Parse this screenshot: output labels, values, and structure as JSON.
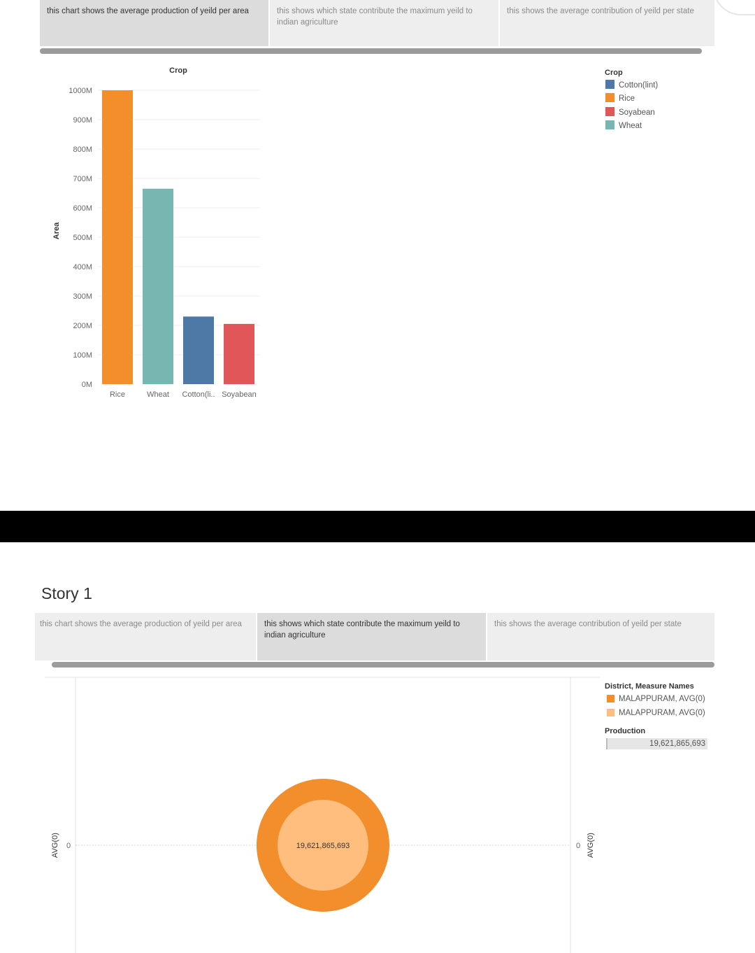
{
  "story": {
    "title": "Story 1",
    "tabs": [
      "this chart shows the average production of yeild per area",
      "this shows which state contribute the maximum yeild to indian agriculture",
      "this shows the average contribution of yeild per state"
    ]
  },
  "colors": {
    "rice": "#f28e2b",
    "wheat": "#76b7b2",
    "cotton": "#4e79a7",
    "soyabean": "#e15759",
    "circle_outer": "#f28e2b",
    "circle_inner": "#ffbe7d"
  },
  "chart_data": [
    {
      "type": "bar",
      "title": "Crop",
      "ylabel": "Area",
      "xlabel": "",
      "ylim": [
        0,
        1000000000
      ],
      "y_ticks": [
        "1000M",
        "900M",
        "800M",
        "700M",
        "600M",
        "500M",
        "400M",
        "300M",
        "200M",
        "100M",
        "0M"
      ],
      "categories": [
        "Rice",
        "Wheat",
        "Cotton(li..",
        "Soyabean"
      ],
      "values": [
        1000000000,
        665000000,
        230000000,
        205000000
      ],
      "bar_colors": [
        "#f28e2b",
        "#76b7b2",
        "#4e79a7",
        "#e15759"
      ],
      "legend": {
        "title": "Crop",
        "placement": "right",
        "items": [
          {
            "label": "Cotton(lint)",
            "color": "#4e79a7"
          },
          {
            "label": "Rice",
            "color": "#f28e2b"
          },
          {
            "label": "Soyabean",
            "color": "#e15759"
          },
          {
            "label": "Wheat",
            "color": "#76b7b2"
          }
        ]
      },
      "grid": true
    },
    {
      "type": "scatter",
      "ylabel_left": "AVG(0)",
      "ylabel_right": "AVG(0)",
      "y_tick_left": "0",
      "y_tick_right": "0",
      "points": [
        {
          "name": "MALAPPURAM, AVG(0)",
          "x": 0,
          "y": 0,
          "production": 19621865693,
          "color": "#f28e2b"
        },
        {
          "name": "MALAPPURAM, AVG(0)",
          "x": 0,
          "y": 0,
          "production": 19621865693,
          "color": "#ffbe7d"
        }
      ],
      "mark_label": "19,621,865,693",
      "legend": {
        "title": "District, Measure Names",
        "placement": "right",
        "items": [
          {
            "label": "MALAPPURAM, AVG(0)",
            "color": "#f28e2b"
          },
          {
            "label": "MALAPPURAM, AVG(0)",
            "color": "#ffbe7d"
          }
        ]
      },
      "size_legend": {
        "title": "Production",
        "value": "19,621,865,693"
      }
    }
  ]
}
